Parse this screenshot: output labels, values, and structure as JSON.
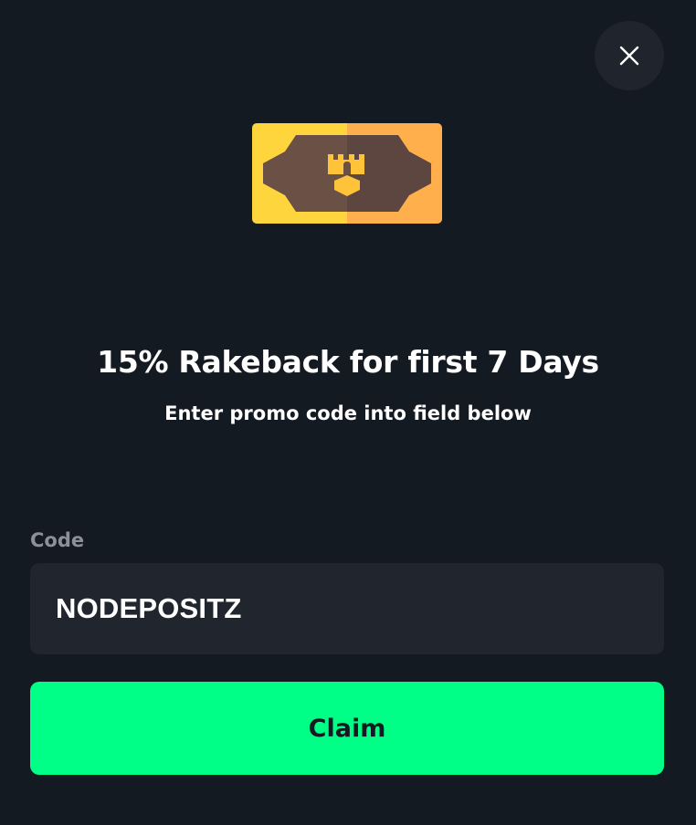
{
  "modal": {
    "close_icon": "close-icon",
    "image_icon": "rakeback-ticket-icon",
    "title": "15% Rakeback for first 7 Days",
    "subtitle": "Enter promo code into field below"
  },
  "form": {
    "code_label": "Code",
    "code_value": "NODEPOSITZ",
    "claim_label": "Claim"
  },
  "colors": {
    "background": "#141a22",
    "input_background": "#21252d",
    "close_button_background": "#20252d",
    "accent": "#00ff87",
    "label": "#8c9199",
    "ticket_left": "#ffd53e",
    "ticket_right": "#ffb04d",
    "ticket_center": "#6b5046"
  }
}
